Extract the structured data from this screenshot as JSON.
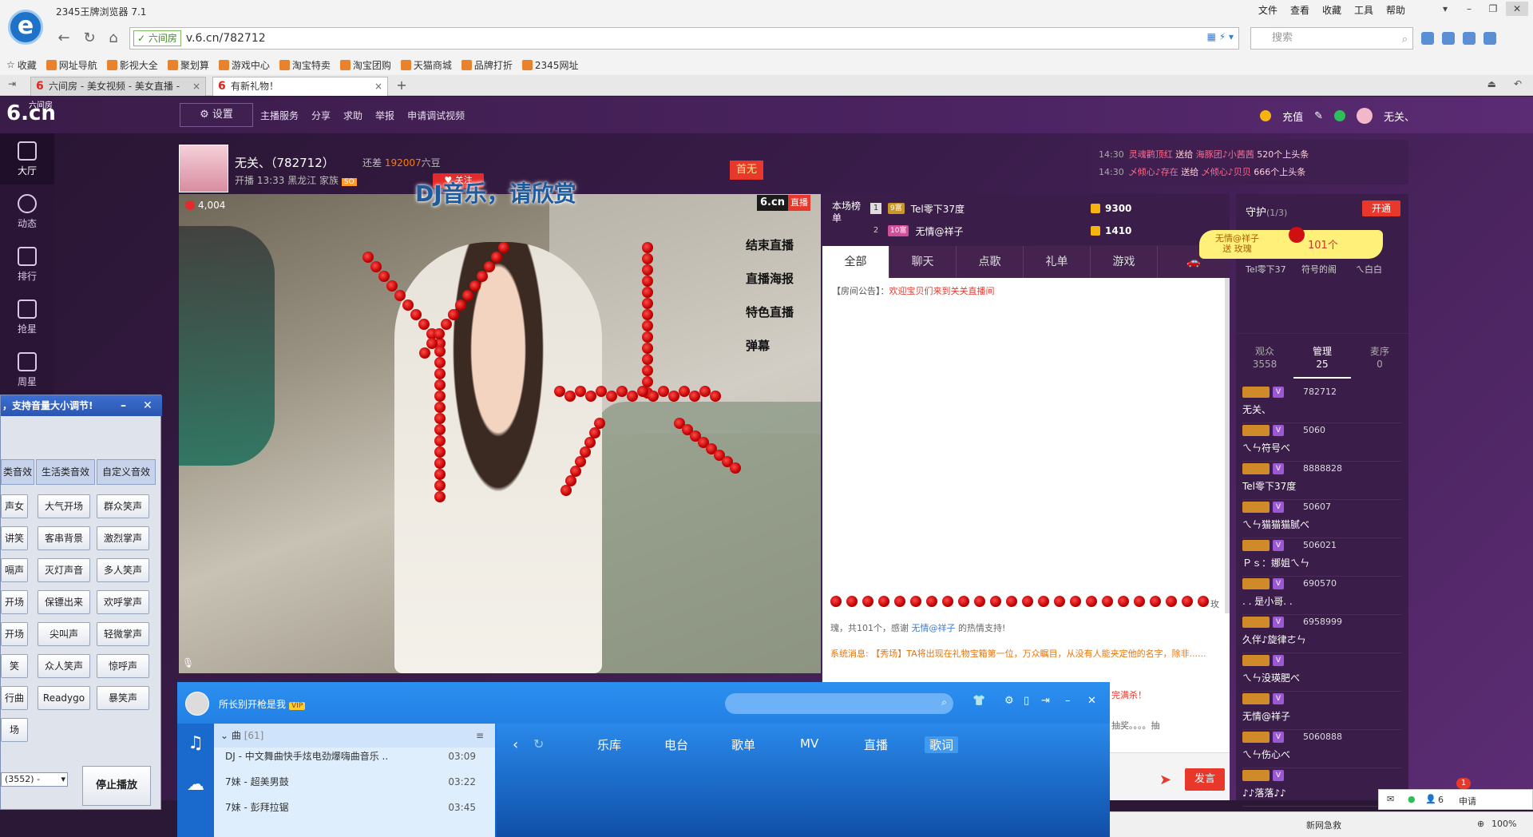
{
  "browser": {
    "title": "2345王牌浏览器 7.1",
    "menu": [
      "文件",
      "查看",
      "收藏",
      "工具",
      "帮助"
    ],
    "secure_label": "六间房",
    "url": "v.6.cn/782712",
    "search_placeholder": "搜索",
    "bookmarks": [
      "收藏",
      "网址导航",
      "影视大全",
      "聚划算",
      "游戏中心",
      "淘宝特卖",
      "淘宝团购",
      "天猫商城",
      "品牌打折",
      "2345网址"
    ],
    "tabs": [
      {
        "title": "六间房 - 美女视频 - 美女直播 -"
      },
      {
        "title": "有新礼物！"
      }
    ],
    "new_tab": "+"
  },
  "site": {
    "logo_small": "六间房",
    "logo": "6.cn",
    "settings": "设置",
    "nav": [
      "主播服务",
      "分享",
      "求助",
      "举报",
      "申请调试视频"
    ],
    "recharge": "充值",
    "user": "无关、"
  },
  "rail": [
    "大厅",
    "动态",
    "排行",
    "抢星",
    "周星"
  ],
  "anchor": {
    "name": "无关、（782712）",
    "need_label": "还差",
    "need_value": "192007",
    "need_unit": "六豆",
    "meta": "开播 13:33  黑龙江  家族",
    "family_tag": "SO",
    "follow": "关注",
    "rank_flag": "首无"
  },
  "video": {
    "viewers": "4,004",
    "overlay_text": "DJ音乐，请欣赏",
    "watermark": "6.cn",
    "live_tag": "直播",
    "menu": [
      "结束直播",
      "直播海报",
      "特色直播",
      "弹幕"
    ]
  },
  "rank": {
    "label": "本场榜单",
    "rows": [
      {
        "num": "1",
        "badge": "9富",
        "name": "Tel零下37度",
        "value": "9300"
      },
      {
        "num": "2",
        "badge": "10富",
        "name": "无情@祥子",
        "value": "1410"
      }
    ]
  },
  "chat": {
    "tabs": [
      "全部",
      "聊天",
      "点歌",
      "礼单",
      "游戏"
    ],
    "notice_label": "【房间公告】：",
    "notice_text": "欢迎宝贝们来到关关直播间",
    "thanks_prefix": "瑰，共101个，感谢",
    "thanks_user": "无情@祥子",
    "thanks_suffix": "的热情支持!",
    "side_char": "玫",
    "system_msg": "系统消息: 【秀场】TA将出现在礼物宝箱第一位，万众瞩目，从没有人能夹定他的名字，除非......",
    "tail1": "完满杀！",
    "tail2": "抽奖。。。。抽",
    "send": "发言"
  },
  "marquee": [
    {
      "time": "14:30",
      "from": "灵魂鹳顶红",
      "verb": "送给",
      "to": "海豚团♪小茜茜",
      "gift": "520个上头条"
    },
    {
      "time": "14:30",
      "from": "乄倾心♪存在",
      "verb": "送给",
      "to": "乄倾心♪贝贝",
      "gift": "666个上头条"
    }
  ],
  "guard": {
    "title": "守护",
    "count": "(1/3)",
    "open": "开通",
    "names": [
      "Tel零下37",
      "符号的阁",
      "ㄟ白白"
    ]
  },
  "gift_popup": {
    "user": "无情@祥子",
    "action": "送 玫瑰",
    "count": "101个"
  },
  "audience": {
    "tabs": [
      {
        "label": "观众",
        "count": "3558"
      },
      {
        "label": "管理",
        "count": "25"
      },
      {
        "label": "麦序",
        "count": "0"
      }
    ],
    "rows": [
      {
        "id": "782712",
        "name": "无关、"
      },
      {
        "id": "5060",
        "name": "ㄟㄣ符号べ"
      },
      {
        "id": "8888828",
        "name": "Tel零下37度"
      },
      {
        "id": "50607",
        "name": "ㄟㄣ猫猫猫腻べ"
      },
      {
        "id": "506021",
        "name": "Ｐｓ：娜姐ㄟㄣ"
      },
      {
        "id": "690570",
        "name": ". . 是小哥. ."
      },
      {
        "id": "6958999",
        "name": "久伴♪旋律ㄜㄣ"
      },
      {
        "id": "",
        "name": "ㄟㄣ没瑛肥べ"
      },
      {
        "id": "",
        "name": "无情@祥子"
      },
      {
        "id": "5060888",
        "name": "ㄟㄣ伤心べ"
      },
      {
        "id": "",
        "name": "♪♪落落♪♪"
      }
    ]
  },
  "sfx": {
    "title": "，支持音量大小调节!",
    "tabs": [
      "类音效",
      "生活类音效",
      "自定义音效"
    ],
    "buttons": [
      [
        "声女",
        "大气开场",
        "群众笑声"
      ],
      [
        "讲笑",
        "客串背景",
        "激烈掌声"
      ],
      [
        "嗝声",
        "灭灯声音",
        "多人笑声"
      ],
      [
        "开场",
        "保镖出来",
        "欢呼掌声"
      ],
      [
        "开场",
        "尖叫声",
        "轻微掌声"
      ],
      [
        "笑",
        "众人笑声",
        "惊呼声"
      ],
      [
        "行曲",
        "Readygo",
        "暴笑声"
      ],
      [
        "场",
        "",
        ""
      ]
    ],
    "select_value": "(3552) -",
    "stop": "停止播放"
  },
  "player": {
    "user": "所长别开枪是我",
    "vip": "VIP",
    "playlist_header": "曲",
    "playlist_count": "[61]",
    "songs": [
      {
        "title": "DJ - 中文舞曲快手炫电劲爆嗨曲音乐 ..",
        "dur": "03:09"
      },
      {
        "title": "7妹 - 超美男鼓",
        "dur": "03:22"
      },
      {
        "title": "7妹 - 彭拜拉锯",
        "dur": "03:45"
      }
    ],
    "nav": [
      "乐库",
      "电台",
      "歌单",
      "MV",
      "直播",
      "歌词"
    ]
  },
  "status": {
    "news": "新网急救",
    "zoom": "100%",
    "notify_count": "6",
    "notify_label": "申请",
    "badge": "1"
  }
}
